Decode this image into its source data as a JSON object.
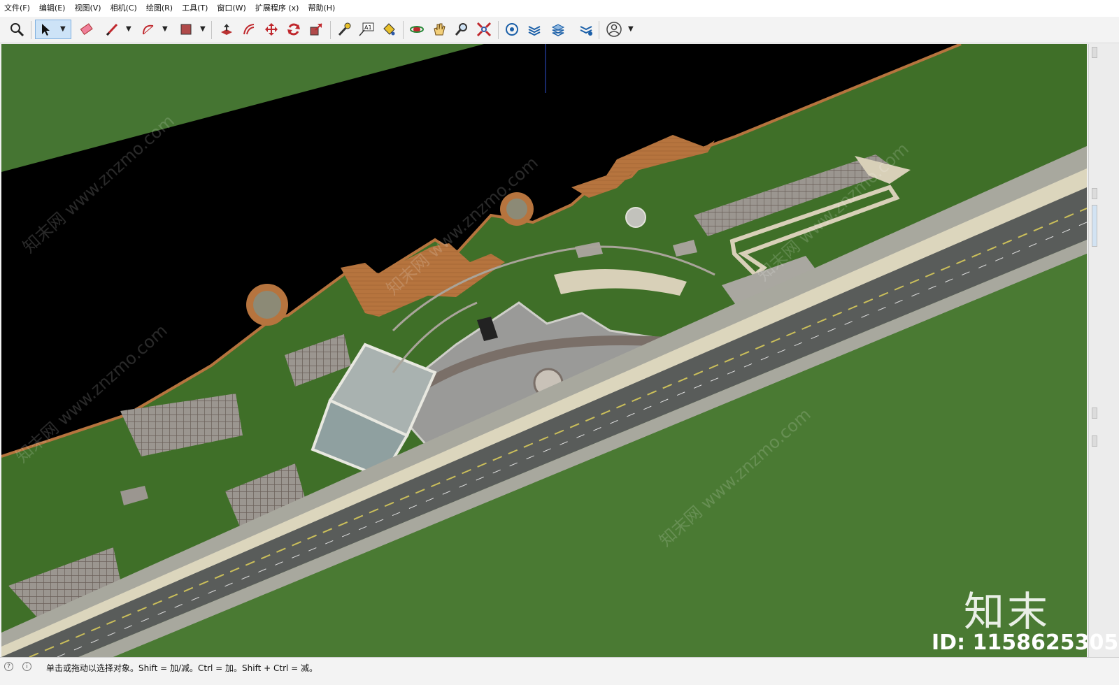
{
  "menu": {
    "items": [
      "文件(F)",
      "编辑(E)",
      "视图(V)",
      "相机(C)",
      "绘图(R)",
      "工具(T)",
      "窗口(W)",
      "扩展程序 (x)",
      "帮助(H)"
    ]
  },
  "toolbar": {
    "tools": [
      {
        "name": "zoom-extents-icon"
      },
      {
        "name": "select-icon",
        "active": true
      },
      {
        "name": "eraser-icon"
      },
      {
        "name": "line-icon"
      },
      {
        "name": "arc-icon"
      },
      {
        "name": "shape-icon"
      },
      {
        "name": "push-pull-icon"
      },
      {
        "name": "offset-icon"
      },
      {
        "name": "move-icon"
      },
      {
        "name": "rotate-icon"
      },
      {
        "name": "scale-icon"
      },
      {
        "name": "tape-measure-icon"
      },
      {
        "name": "text-icon"
      },
      {
        "name": "paint-bucket-icon"
      },
      {
        "name": "orbit-icon"
      },
      {
        "name": "pan-icon"
      },
      {
        "name": "zoom-icon"
      },
      {
        "name": "zoom-window-icon"
      },
      {
        "name": "warehouse-icon"
      },
      {
        "name": "extension-icon"
      },
      {
        "name": "layers-icon"
      },
      {
        "name": "extension-manager-icon"
      },
      {
        "name": "account-icon"
      }
    ],
    "text_tool_label": "A1"
  },
  "viewport": {
    "watermark_site": "知末网 www.znzmo.com",
    "colors": {
      "grass": "#3d6e26",
      "water": "#000000",
      "road": "#595c5a",
      "deck": "#b6743e",
      "paving": "#a3a39b"
    }
  },
  "watermark": {
    "logo_text": "知末",
    "id_text": "ID: 1158625305"
  },
  "status": {
    "message": "单击或拖动以选择对象。Shift = 加/减。Ctrl = 加。Shift + Ctrl = 减。"
  }
}
